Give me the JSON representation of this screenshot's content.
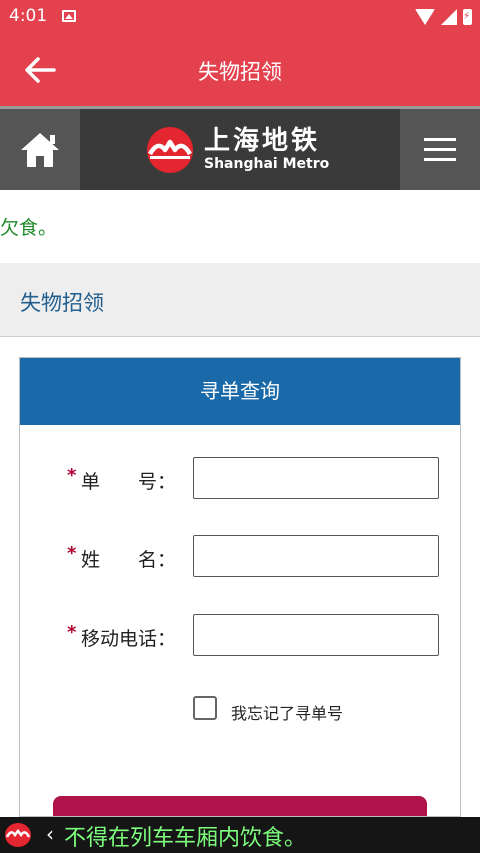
{
  "status_bar": {
    "time": "4:01"
  },
  "app_bar": {
    "title": "失物招领"
  },
  "brand": {
    "name_cn": "上海地铁",
    "name_en": "Shanghai Metro"
  },
  "notice": {
    "text": "欠食。"
  },
  "section": {
    "title": "失物招领"
  },
  "form": {
    "header": "寻单查询",
    "fields": [
      {
        "label": "单　　号：",
        "value": ""
      },
      {
        "label": "姓　　名：",
        "value": ""
      },
      {
        "label": "移动电话：",
        "value": ""
      }
    ],
    "required_mark": "*",
    "forgot_label": "我忘记了寻单号",
    "forgot_checked": false
  },
  "bottom_bar": {
    "chevron": "‹",
    "ticker": "不得在列车车厢内饮食。"
  },
  "colors": {
    "app_red": "#e3414e",
    "header_dark": "#3a3a3a",
    "card_blue": "#1a6aa9",
    "button_crimson": "#b0134a",
    "ticker_green": "#7dff7d"
  }
}
